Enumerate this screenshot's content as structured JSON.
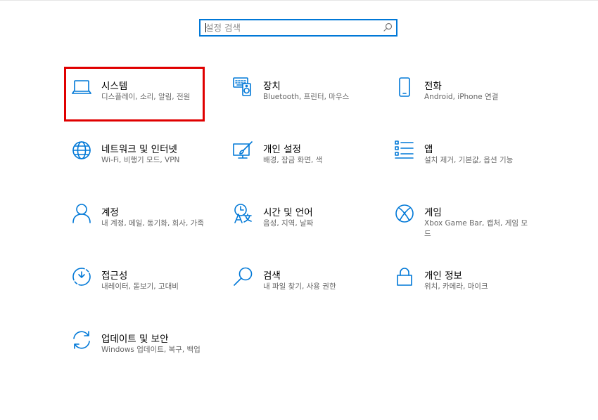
{
  "search": {
    "placeholder": "설정 검색",
    "icon": "search-icon"
  },
  "accent_color": "#0078d7",
  "highlight_color": "#e00000",
  "tiles": [
    {
      "title": "시스템",
      "desc": "디스플레이, 소리, 알림, 전원",
      "icon": "laptop-icon"
    },
    {
      "title": "장치",
      "desc": "Bluetooth, 프린터, 마우스",
      "icon": "keyboard-speaker-icon"
    },
    {
      "title": "전화",
      "desc": "Android, iPhone 연결",
      "icon": "phone-icon"
    },
    {
      "title": "네트워크 및 인터넷",
      "desc": "Wi-Fi, 비행기 모드, VPN",
      "icon": "globe-icon"
    },
    {
      "title": "개인 설정",
      "desc": "배경, 잠금 화면, 색",
      "icon": "paint-brush-icon"
    },
    {
      "title": "앱",
      "desc": "설치 제거, 기본값, 옵션 기능",
      "icon": "app-list-icon"
    },
    {
      "title": "계정",
      "desc": "내 계정, 메일, 동기화, 회사, 가족",
      "icon": "person-icon"
    },
    {
      "title": "시간 및 언어",
      "desc": "음성, 지역, 날짜",
      "icon": "time-language-icon"
    },
    {
      "title": "게임",
      "desc": "Xbox Game Bar, 캡처, 게임 모드",
      "icon": "xbox-icon"
    },
    {
      "title": "접근성",
      "desc": "내레이터, 돋보기, 고대비",
      "icon": "ease-of-access-icon"
    },
    {
      "title": "검색",
      "desc": "내 파일 찾기, 사용 권한",
      "icon": "magnifier-icon"
    },
    {
      "title": "개인 정보",
      "desc": "위치, 카메라, 마이크",
      "icon": "lock-icon"
    },
    {
      "title": "업데이트 및 보안",
      "desc": "Windows 업데이트, 복구, 백업",
      "icon": "sync-icon"
    }
  ]
}
